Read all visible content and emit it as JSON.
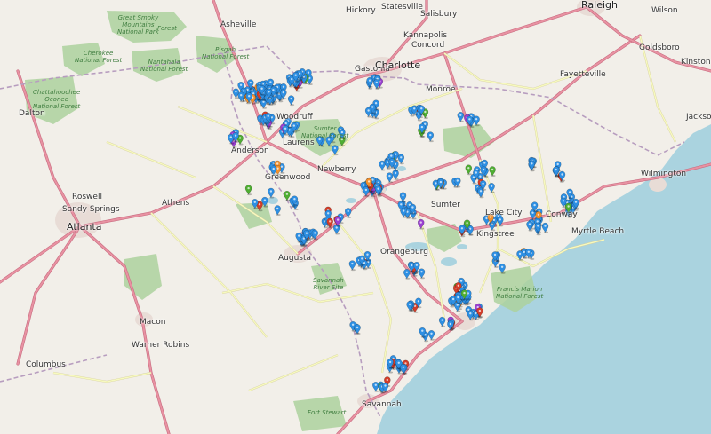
{
  "map": {
    "labels": {
      "cities": [
        "Statesville",
        "Salisbury",
        "Raleigh",
        "Hickory",
        "Wilson",
        "Kannapolis",
        "Concord",
        "Goldsboro",
        "Gastonia",
        "Charlotte",
        "Monroe",
        "Kinston",
        "Fayetteville",
        "Asheville",
        "Jacksonville",
        "Woodruff",
        "Laurens",
        "Greenwood",
        "Newberry",
        "Roswell",
        "Athens",
        "Sandy Springs",
        "Atlanta",
        "Augusta",
        "Orangeburg",
        "Sumter",
        "Lake City",
        "Kingstree",
        "Conway",
        "Wilmington",
        "Macon",
        "Warner Robins",
        "Savannah",
        "Columbus",
        "Dalton",
        "Myrtle Beach",
        "Anderson"
      ],
      "parks": [
        "Great Smoky Mountains National Park",
        "Pisgah National Forest",
        "Nantahala National Forest",
        "Cherokee National Forest",
        "Chattahoochee Oconee National Forest",
        "Sumter National Forest",
        "Savannah River Site",
        "Francis Marion National Forest",
        "Fort Stewart",
        "Forest"
      ]
    },
    "markers": {
      "colors": {
        "blue": "#2d8fe3",
        "red": "#d33d29",
        "green": "#4fae32",
        "orange": "#f2902c",
        "purple": "#9a3fd1"
      },
      "legend_names": [
        "blue",
        "red",
        "green",
        "orange",
        "purple"
      ]
    },
    "colors": {
      "land": "#f2efe9",
      "water": "#aad3df",
      "forest": "#add19e",
      "urban": "#e8dcd6",
      "highway": "#e892a2",
      "road": "#f7fabf",
      "border": "#b79dbf"
    }
  }
}
